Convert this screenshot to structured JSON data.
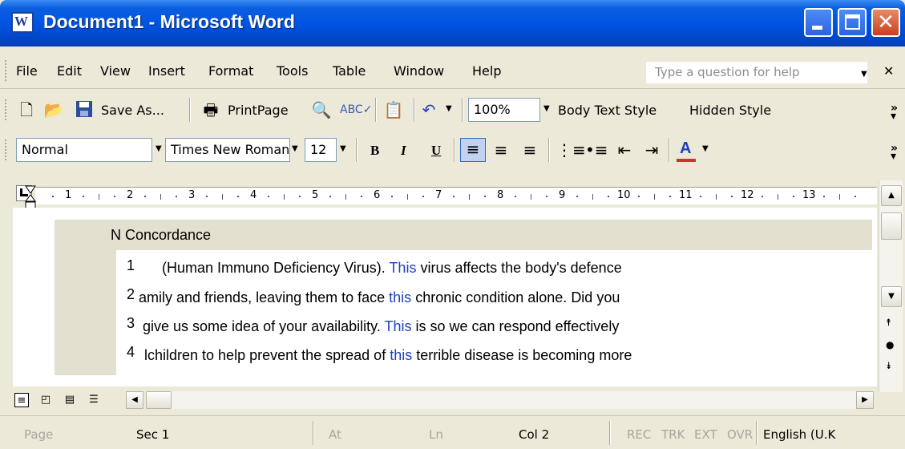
{
  "window": {
    "title": "Document1 - Microsoft Word",
    "app_icon_letter": "W",
    "close_glyph": "✕"
  },
  "menu": {
    "items": [
      "File",
      "Edit",
      "View",
      "Insert",
      "Format",
      "Tools",
      "Table",
      "Window",
      "Help"
    ],
    "help_placeholder": "Type a question for help",
    "close_glyph": "✕"
  },
  "standard_toolbar": {
    "save_as_label": "Save As...",
    "print_page_label": "PrintPage",
    "zoom_value": "100%",
    "body_text_style_label": "Body Text Style",
    "hidden_style_label": "Hidden Style"
  },
  "formatting_toolbar": {
    "style_value": "Normal",
    "font_value": "Times New Roman",
    "size_value": "12",
    "bold_label": "B",
    "italic_label": "I",
    "underline_label": "U",
    "font_color_label": "A",
    "font_color": "#c0392b"
  },
  "ruler": {
    "numbers": [
      "1",
      "2",
      "3",
      "4",
      "5",
      "6",
      "7",
      "8",
      "9",
      "10",
      "11",
      "12",
      "13"
    ]
  },
  "concordance": {
    "header_n": "N",
    "header_title": "Concordance",
    "keyword_color": "#1f3fbf",
    "lines": [
      {
        "n": "1",
        "pre": "(Human Immuno Deficiency Virus). ",
        "kw": "This",
        "post": " virus affects the body's defence"
      },
      {
        "n": "2",
        "pre": "amily and friends, leaving them to face ",
        "kw": "this",
        "post": " chronic condition alone. Did you"
      },
      {
        "n": "3",
        "pre": "give us some idea of your availability. ",
        "kw": "This",
        "post": " is so we can respond effectively"
      },
      {
        "n": "4",
        "pre": "lchildren to help prevent the spread of ",
        "kw": "this",
        "post": " terrible disease is becoming more"
      }
    ]
  },
  "status_bar": {
    "page": "Page",
    "sec": "Sec 1",
    "at": "At",
    "ln": "Ln",
    "col": "Col 2",
    "rec": "REC",
    "trk": "TRK",
    "ext": "EXT",
    "ovr": "OVR",
    "language": "English (U.K"
  },
  "icons": {
    "new": "new-document-icon",
    "open": "open-folder-icon",
    "save": "save-disk-icon",
    "print": "printer-icon",
    "preview": "print-preview-icon",
    "spelling": "spelling-icon",
    "paste": "paste-icon",
    "undo": "undo-icon"
  }
}
